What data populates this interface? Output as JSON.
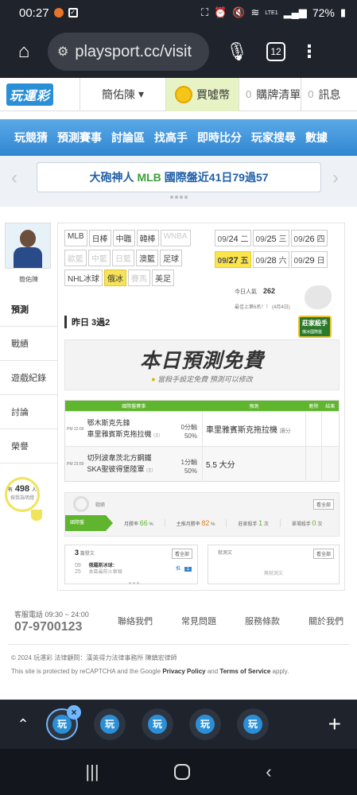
{
  "status_bar": {
    "time": "00:27",
    "battery": "72%",
    "net": "LTE1"
  },
  "browser": {
    "url": "playsport.cc/visit",
    "tab_count": "12"
  },
  "header": {
    "logo": "玩運彩",
    "user": "簡佑陳",
    "coins_label": "買噓幣",
    "cart_count": "0",
    "cart_label": "購牌清單",
    "msg_count": "0",
    "msg_label": "訊息"
  },
  "nav": [
    "玩競猜",
    "預測賽事",
    "討論區",
    "找高手",
    "即時比分",
    "玩家搜尋",
    "數據"
  ],
  "banner": {
    "pre": "大砲神人",
    "hl": "MLB",
    "post": "國際盤近41日79過57"
  },
  "profile": {
    "name": "簡佑陳"
  },
  "sidemenu": [
    "預測",
    "戰績",
    "遊戲紀錄",
    "討論",
    "榮譽"
  ],
  "counter": {
    "num": "498",
    "unit": "人",
    "prefix": "有",
    "text": "按我為明燈"
  },
  "leagues": [
    {
      "label": "MLB",
      "state": "normal"
    },
    {
      "label": "日棒",
      "state": "normal"
    },
    {
      "label": "中職",
      "state": "normal"
    },
    {
      "label": "韓棒",
      "state": "normal"
    },
    {
      "label": "WNBA",
      "state": "disabled"
    },
    {
      "label": "歐籃",
      "state": "disabled"
    },
    {
      "label": "中籃",
      "state": "disabled"
    },
    {
      "label": "日籃",
      "state": "disabled"
    },
    {
      "label": "澳籃",
      "state": "normal"
    },
    {
      "label": "足球",
      "state": "normal"
    },
    {
      "label": "NHL冰球",
      "state": "normal"
    },
    {
      "label": "俄冰",
      "state": "selected"
    },
    {
      "label": "賽馬",
      "state": "disabled"
    },
    {
      "label": "美足",
      "state": "normal"
    }
  ],
  "dates": [
    {
      "md": "09/",
      "d": "24",
      "w": "二",
      "sel": false
    },
    {
      "md": "09/",
      "d": "25",
      "w": "三",
      "sel": false
    },
    {
      "md": "09/",
      "d": "26",
      "w": "四",
      "sel": false
    },
    {
      "md": "09/",
      "d": "27",
      "w": "五",
      "sel": true
    },
    {
      "md": "09/",
      "d": "28",
      "w": "六",
      "sel": false
    },
    {
      "md": "09/",
      "d": "29",
      "w": "日",
      "sel": false
    }
  ],
  "popularity": {
    "label": "今日人氣",
    "value": "262",
    "rank": "最佳上第6名！！ (4月4日)"
  },
  "badge": {
    "label": "莊家殺手",
    "sub": "俄冰國際盤"
  },
  "yesterday": "昨日 3過2",
  "free": {
    "title": "本日預測免費",
    "sub": "當殺手設定免費 預測可以修改"
  },
  "table": {
    "headers": [
      "國際盤賽事",
      "預測",
      "刪除",
      "結果"
    ],
    "rows": [
      {
        "time": "PM 22:00",
        "home": "鄂木斯克先鋒",
        "home_tag": "",
        "away": "車里雅賓斯克拖拉機",
        "away_tag": "(主)",
        "line1": "0分輸",
        "line2": "50%",
        "pred": "車里雅賓斯克拖拉機",
        "pred_tag": "讓分"
      },
      {
        "time": "PM 23:59",
        "home": "切列波韋茨北方鋼鐵",
        "home_tag": "",
        "away": "SKA聖彼得堡陸軍",
        "away_tag": "(主)",
        "line1": "1分輸",
        "line2": "50%",
        "pred": "5.5 大分",
        "pred_tag": ""
      }
    ]
  },
  "stats": {
    "title": "戰績",
    "more": "看全部",
    "tab": "國際盤",
    "monthly": "月勝率",
    "monthly_val": "66",
    "season": "主推月勝率",
    "season_val": "82",
    "killer": "莊家殺手",
    "killer_val": "1",
    "single": "單場殺手",
    "single_val": "0",
    "pct": "%",
    "times": "次"
  },
  "posts": {
    "count": "3",
    "label": "篇發文",
    "more": "看全部",
    "date_a": "09",
    "date_b": "25",
    "item": "俄羅斯冰球：",
    "item_sub": "本區最前火車頭",
    "reply_label": "推",
    "reply": "1"
  },
  "test": {
    "title": "就測文",
    "more": "看全部",
    "empty": "無就測文"
  },
  "footer": {
    "svc": "客服電話 09:30 ~ 24:00",
    "phone": "07-9700123",
    "links": [
      "聯絡我們",
      "常見問題",
      "服務條款",
      "關於我們"
    ],
    "copy": "© 2024 玩運彩 法律顧問：漢英得力法律事務所 陳鎮宏律師",
    "recaptcha": "This site is protected by reCAPTCHA and the Google",
    "pp": "Privacy Policy",
    "and": "and",
    "tos": "Terms of Service",
    "apply": "apply."
  },
  "tabstrip": {
    "fav": "玩"
  }
}
